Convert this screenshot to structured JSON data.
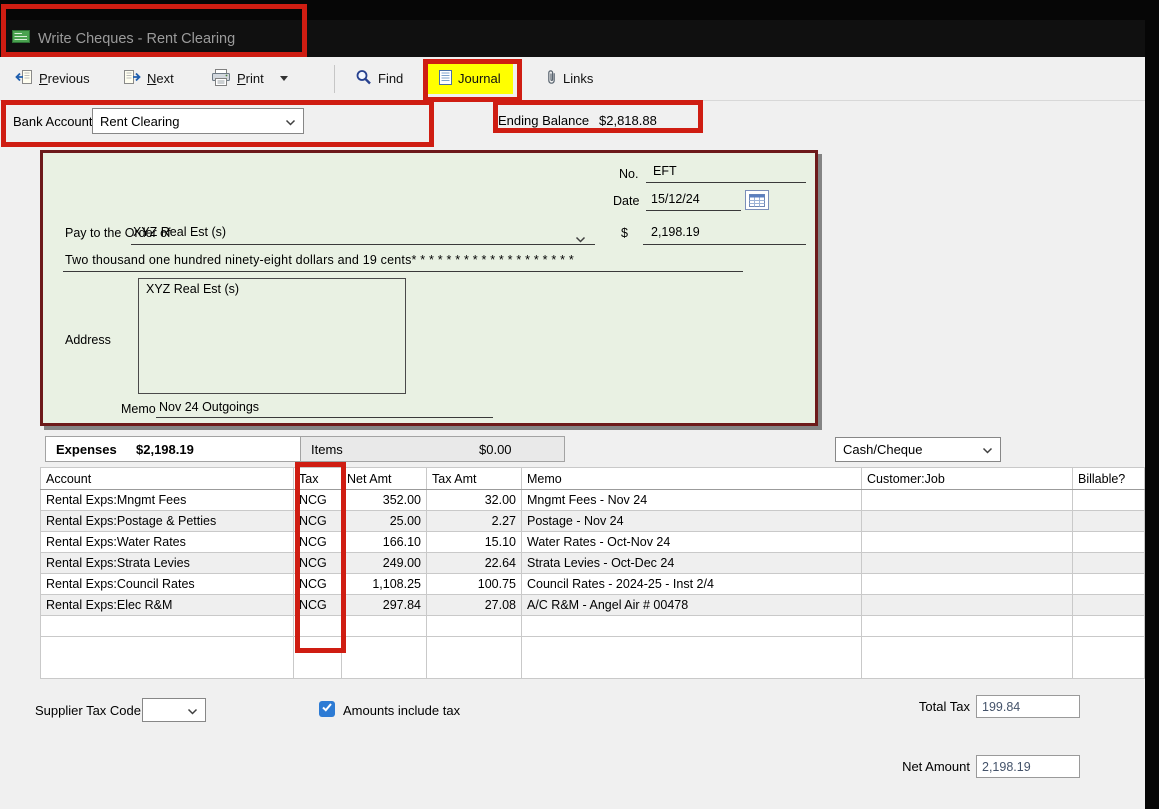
{
  "window": {
    "title": "Write Cheques - Rent Clearing"
  },
  "toolbar": {
    "previous_label": "Previous",
    "next_label": "Next",
    "print_label": "Print",
    "find_label": "Find",
    "journal_label": "Journal",
    "links_label": "Links"
  },
  "bank_row": {
    "bank_account_label": "Bank Account",
    "bank_account_value": "Rent Clearing",
    "ending_balance_label": "Ending Balance",
    "ending_balance_value": "$2,818.88"
  },
  "cheque": {
    "no_label": "No.",
    "no_value": "EFT",
    "date_label": "Date",
    "date_value": "15/12/24",
    "pay_to_label": "Pay to the Order of",
    "payee": "XYZ Real Est (s)",
    "currency_symbol": "$",
    "amount": "2,198.19",
    "amount_in_words": "Two thousand one hundred ninety-eight dollars and 19 cents* * * * * * * * * * * * * * * * * * *",
    "address_label": "Address",
    "address_value": "XYZ Real Est (s)",
    "memo_label": "Memo",
    "memo_value": "Nov 24 Outgoings"
  },
  "tabs": {
    "expenses_label": "Expenses",
    "expenses_total": "$2,198.19",
    "items_label": "Items",
    "items_total": "$0.00",
    "payment_method": "Cash/Cheque"
  },
  "expense_table": {
    "headers": [
      "Account",
      "Tax",
      "Net Amt",
      "Tax Amt",
      "Memo",
      "Customer:Job",
      "Billable?"
    ],
    "rows": [
      {
        "account": "Rental Exps:Mngmt Fees",
        "tax": "NCG",
        "net_amt": "352.00",
        "tax_amt": "32.00",
        "memo": "Mngmt Fees - Nov 24",
        "customer_job": "",
        "billable": ""
      },
      {
        "account": "Rental Exps:Postage & Petties",
        "tax": "NCG",
        "net_amt": "25.00",
        "tax_amt": "2.27",
        "memo": "Postage - Nov 24",
        "customer_job": "",
        "billable": ""
      },
      {
        "account": "Rental Exps:Water Rates",
        "tax": "NCG",
        "net_amt": "166.10",
        "tax_amt": "15.10",
        "memo": "Water Rates - Oct-Nov 24",
        "customer_job": "",
        "billable": ""
      },
      {
        "account": "Rental Exps:Strata Levies",
        "tax": "NCG",
        "net_amt": "249.00",
        "tax_amt": "22.64",
        "memo": "Strata Levies - Oct-Dec 24",
        "customer_job": "",
        "billable": ""
      },
      {
        "account": "Rental Exps:Council Rates",
        "tax": "NCG",
        "net_amt": "1,108.25",
        "tax_amt": "100.75",
        "memo": "Council Rates - 2024-25 - Inst 2/4",
        "customer_job": "",
        "billable": ""
      },
      {
        "account": "Rental Exps:Elec R&M",
        "tax": "NCG",
        "net_amt": "297.84",
        "tax_amt": "27.08",
        "memo": "A/C R&M - Angel Air # 00478",
        "customer_job": "",
        "billable": ""
      }
    ]
  },
  "footer": {
    "supplier_tax_code_label": "Supplier Tax Code",
    "supplier_tax_code_value": "",
    "amounts_include_tax_label": "Amounts include tax",
    "amounts_include_tax_checked": true,
    "total_tax_label": "Total Tax",
    "total_tax_value": "199.84",
    "net_amount_label": "Net Amount",
    "net_amount_value": "2,198.19"
  },
  "colors": {
    "annotation_red": "#cf1d12",
    "journal_highlight": "#ffff00",
    "cheque_background": "#e9f1e3",
    "cheque_border": "#6d1a1a"
  }
}
